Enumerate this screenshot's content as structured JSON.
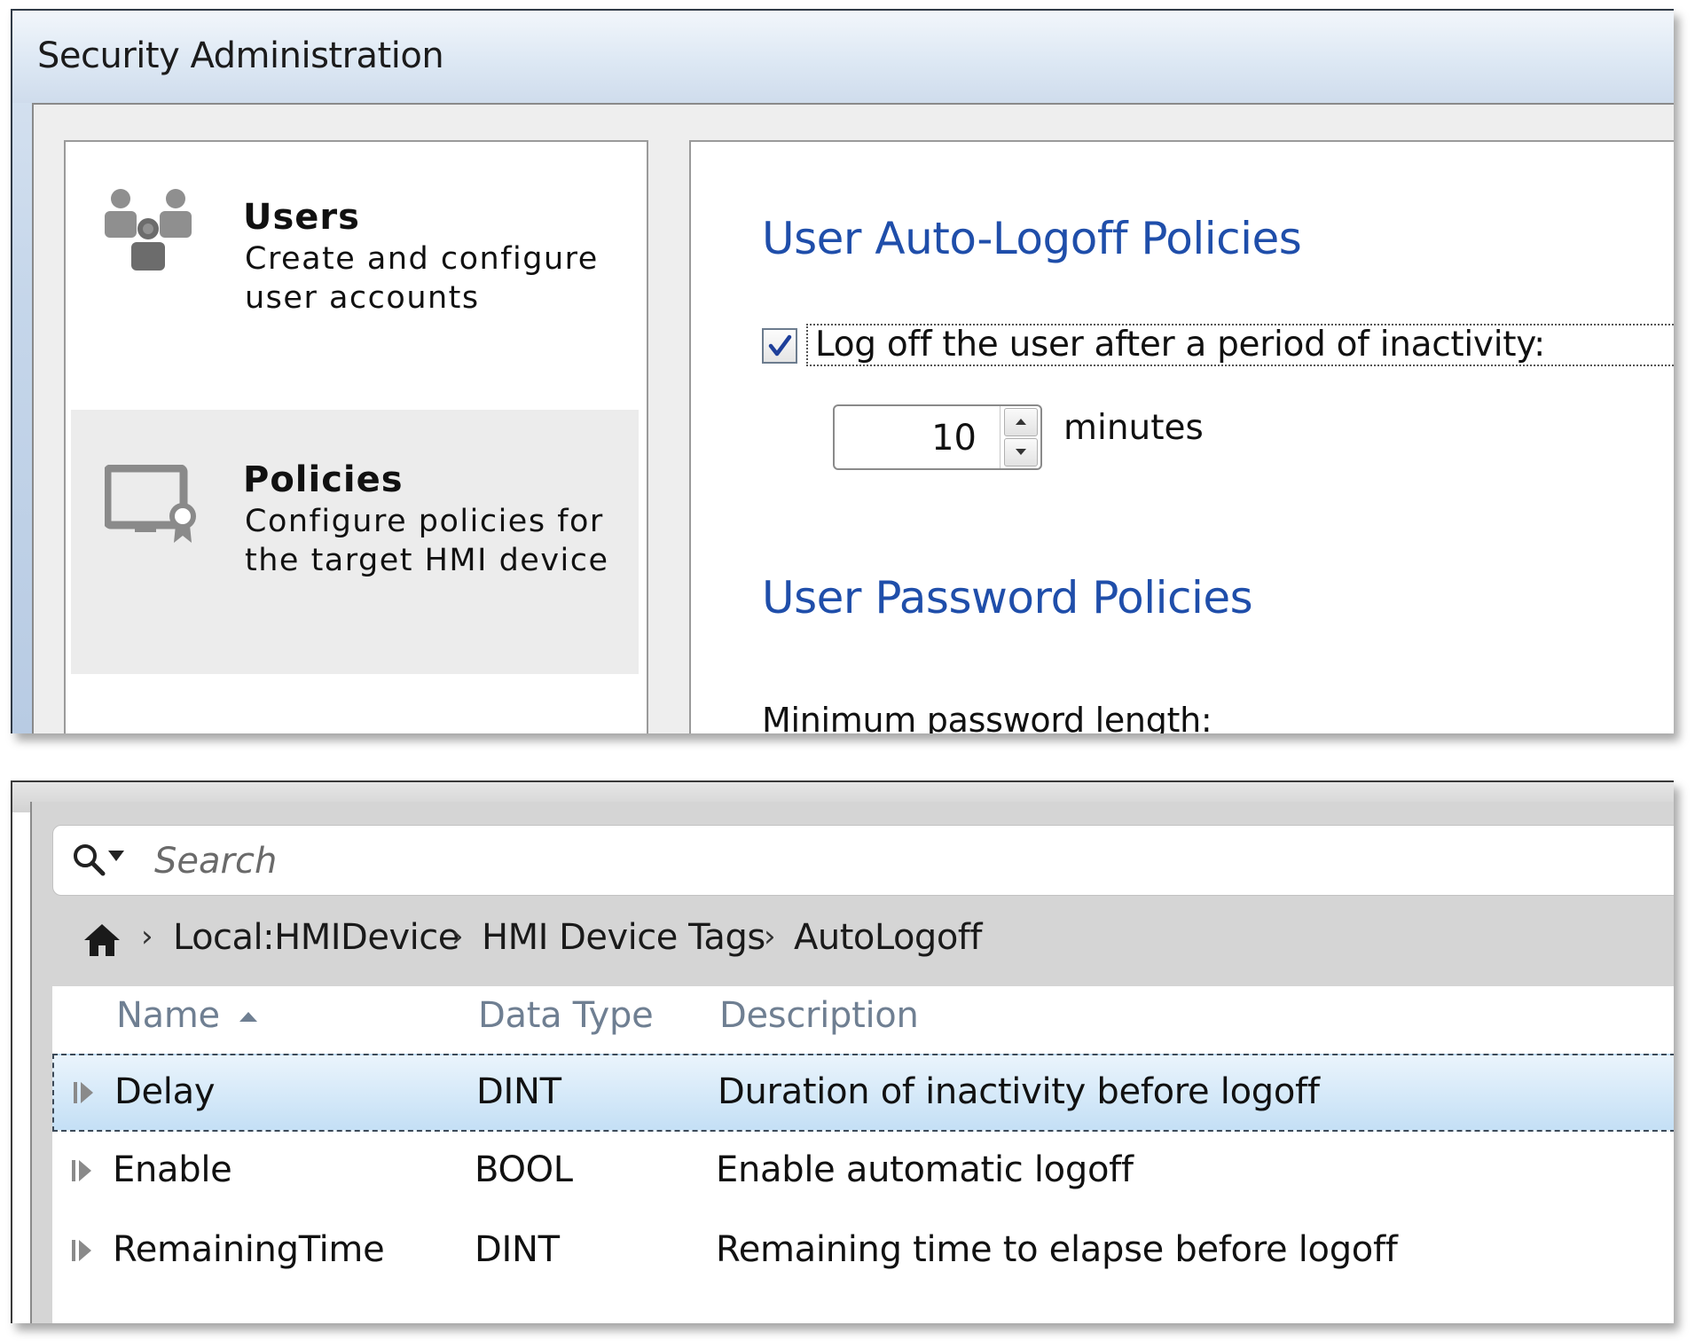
{
  "window": {
    "title": "Security Administration"
  },
  "nav": {
    "items": [
      {
        "icon": "users-icon",
        "title": "Users",
        "description": "Create and configure user accounts"
      },
      {
        "icon": "policies-icon",
        "title": "Policies",
        "description": "Configure policies for the target HMI device",
        "selected": true
      }
    ]
  },
  "policies": {
    "auto_logoff": {
      "heading": "User Auto-Logoff Policies",
      "checkbox_label": "Log off the user after a period of inactivity:",
      "checked": true,
      "timeout_value": "10",
      "timeout_unit": "minutes"
    },
    "password": {
      "heading": "User Password Policies",
      "min_length_label": "Minimum password length:"
    }
  },
  "tag_browser": {
    "search": {
      "placeholder": "Search",
      "icon": "search-icon"
    },
    "breadcrumb": {
      "home_icon": "home-icon",
      "items": [
        "Local:HMIDevice",
        "HMI Device Tags",
        "AutoLogoff"
      ]
    },
    "columns": {
      "name": "Name",
      "data_type": "Data Type",
      "description": "Description"
    },
    "rows": [
      {
        "name": "Delay",
        "data_type": "DINT",
        "description": "Duration of inactivity before logoff",
        "selected": true
      },
      {
        "name": "Enable",
        "data_type": "BOOL",
        "description": "Enable automatic logoff"
      },
      {
        "name": "RemainingTime",
        "data_type": "DINT",
        "description": "Remaining time to elapse before logoff"
      }
    ]
  },
  "colors": {
    "heading_blue": "#1f4eaa",
    "selection_blue": "#c4dff5",
    "column_header_gray": "#6f7f92"
  }
}
